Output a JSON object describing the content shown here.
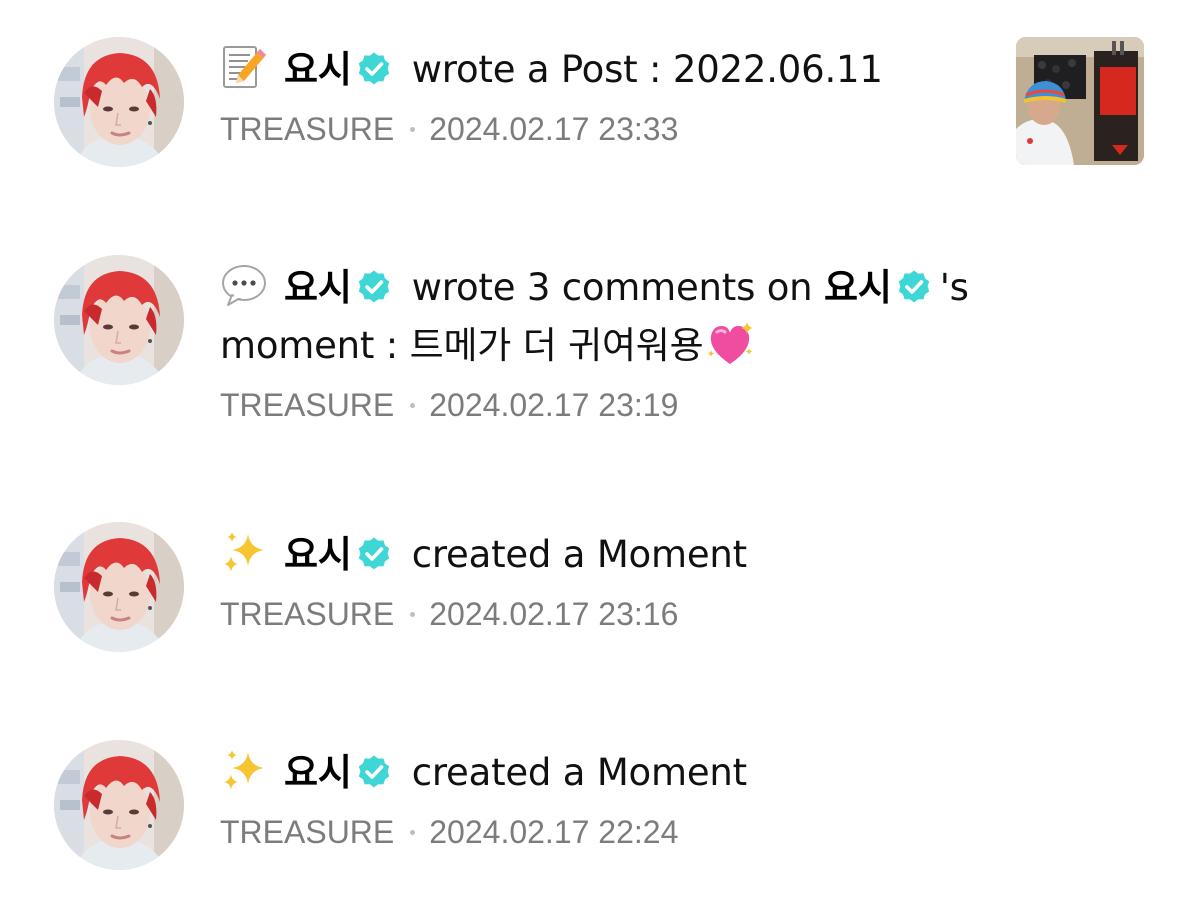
{
  "feed": {
    "items": [
      {
        "emoji": "memo-emoji",
        "username": "요시",
        "action": "wrote a Post : 2022.06.11",
        "group": "TREASURE",
        "timestamp": "2024.02.17 23:33",
        "has_thumbnail": true
      },
      {
        "emoji": "speech-bubble-emoji",
        "username": "요시",
        "action_prefix": "wrote 3 comments on",
        "target_username": "요시",
        "action_suffix": "'s",
        "action_line2": "moment : 트메가 더 귀여워용",
        "trailing_emoji": "sparkling-heart-emoji",
        "group": "TREASURE",
        "timestamp": "2024.02.17 23:19"
      },
      {
        "emoji": "sparkles-emoji",
        "username": "요시",
        "action": "created a Moment",
        "group": "TREASURE",
        "timestamp": "2024.02.17 23:16"
      },
      {
        "emoji": "sparkles-emoji",
        "username": "요시",
        "action": "created a Moment",
        "group": "TREASURE",
        "timestamp": "2024.02.17 22:24"
      }
    ]
  },
  "colors": {
    "verified_badge": "#3fd6d6",
    "meta_text": "#7c7c7c",
    "primary_text": "#111111"
  }
}
